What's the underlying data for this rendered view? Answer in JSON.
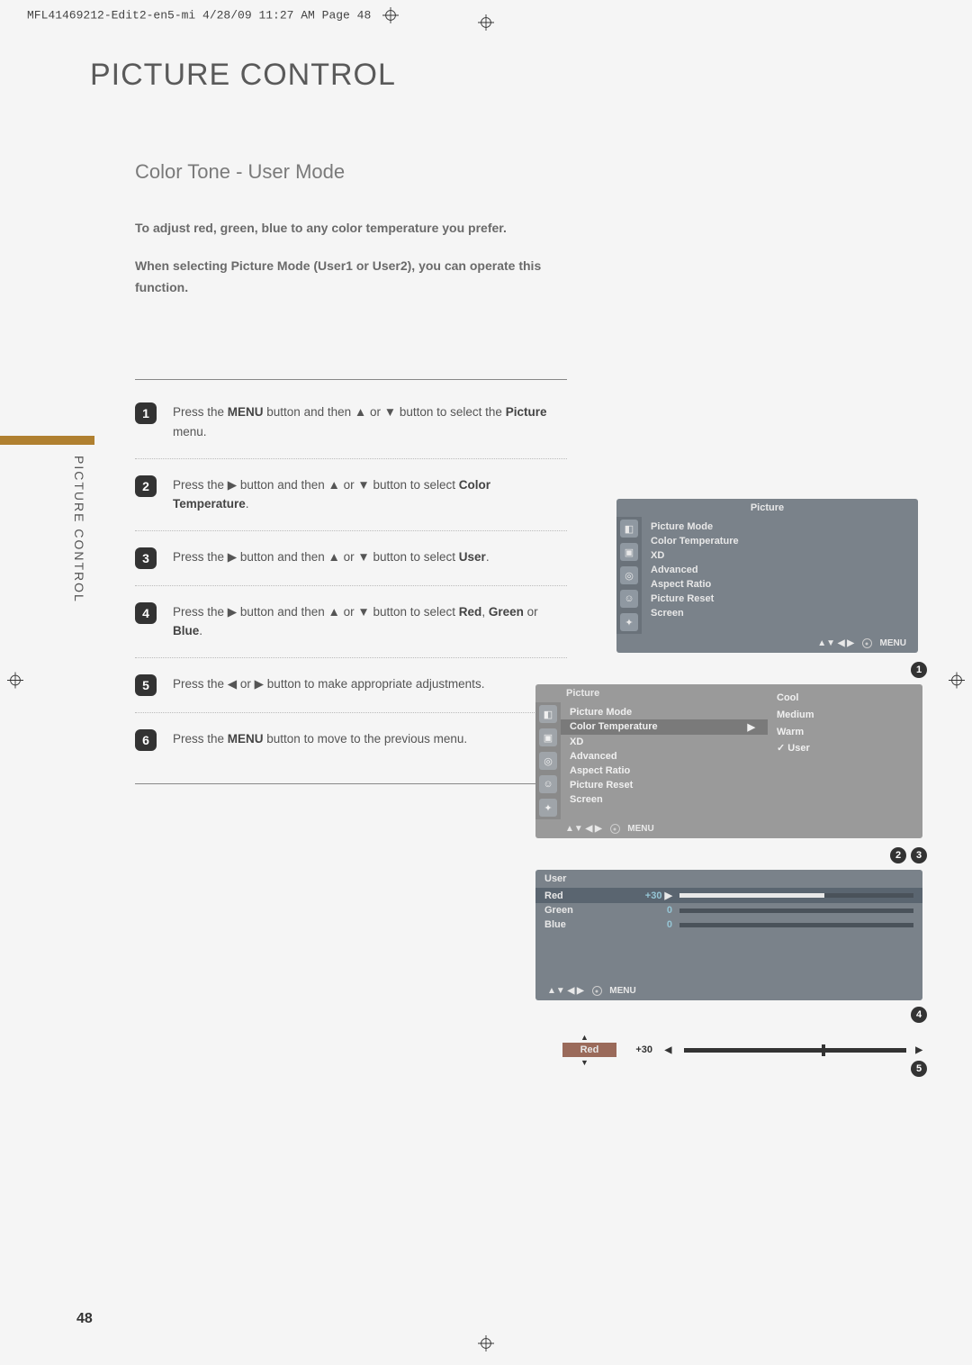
{
  "header": {
    "job_string": "MFL41469212-Edit2-en5-mi  4/28/09 11:27 AM  Page 48"
  },
  "page_title": "PICTURE CONTROL",
  "section_title": "Color Tone - User Mode",
  "intro_1": "To adjust red, green, blue to any color temperature you prefer.",
  "intro_2": "When selecting Picture Mode (User1 or User2), you can operate this function.",
  "side_label": "PICTURE CONTROL",
  "steps": [
    {
      "n": "1",
      "pre": "Press the ",
      "b1": "MENU",
      "mid": " button and then ▲ or ▼ button to select the ",
      "b2": "Picture",
      "post": " menu."
    },
    {
      "n": "2",
      "pre": "Press the ▶ button and then ▲ or ▼ button to select ",
      "b1": "Color Temperature",
      "mid": "",
      "b2": "",
      "post": "."
    },
    {
      "n": "3",
      "pre": "Press the ▶  button and then ▲ or ▼ button to select ",
      "b1": "User",
      "mid": "",
      "b2": "",
      "post": "."
    },
    {
      "n": "4",
      "pre": "Press the ▶ button and then ▲ or ▼ button to select ",
      "b1": "Red",
      "mid": ", ",
      "b2": "Green",
      "post": " or Blue."
    },
    {
      "n": "5",
      "pre": "Press the ◀ or ▶ button to make appropriate adjustments.",
      "b1": "",
      "mid": "",
      "b2": "",
      "post": ""
    },
    {
      "n": "6",
      "pre": "Press the ",
      "b1": "MENU",
      "mid": " button to move to the previous menu.",
      "b2": "",
      "post": ""
    }
  ],
  "osd_menu_title": "Picture",
  "osd_items": [
    "Picture Mode",
    "Color Temperature",
    "XD",
    "Advanced",
    "Aspect Ratio",
    "Picture Reset",
    "Screen"
  ],
  "osd_icons": [
    "◧",
    "▣",
    "◎",
    "☺",
    "✦"
  ],
  "nav_arrows": "▲▼  ◀ ▶",
  "nav_menu": "MENU",
  "color_opts": {
    "cool": "Cool",
    "medium": "Medium",
    "warm": "Warm",
    "user": "User"
  },
  "user_panel": {
    "title": "User",
    "rows": [
      {
        "label": "Red",
        "value": "+30",
        "arrow": "▶",
        "fill": 62
      },
      {
        "label": "Green",
        "value": "0",
        "arrow": "",
        "fill": 0
      },
      {
        "label": "Blue",
        "value": "0",
        "arrow": "",
        "fill": 0
      }
    ]
  },
  "slider": {
    "label": "Red",
    "value": "+30",
    "arrow_l": "◀",
    "arrow_r": "▶",
    "arrow_u": "▲",
    "arrow_d": "▼",
    "pos": 62
  },
  "callouts": {
    "c1": "1",
    "c2": "2",
    "c3": "3",
    "c4": "4",
    "c5": "5"
  },
  "page_number": "48",
  "triangle_right": "▶"
}
